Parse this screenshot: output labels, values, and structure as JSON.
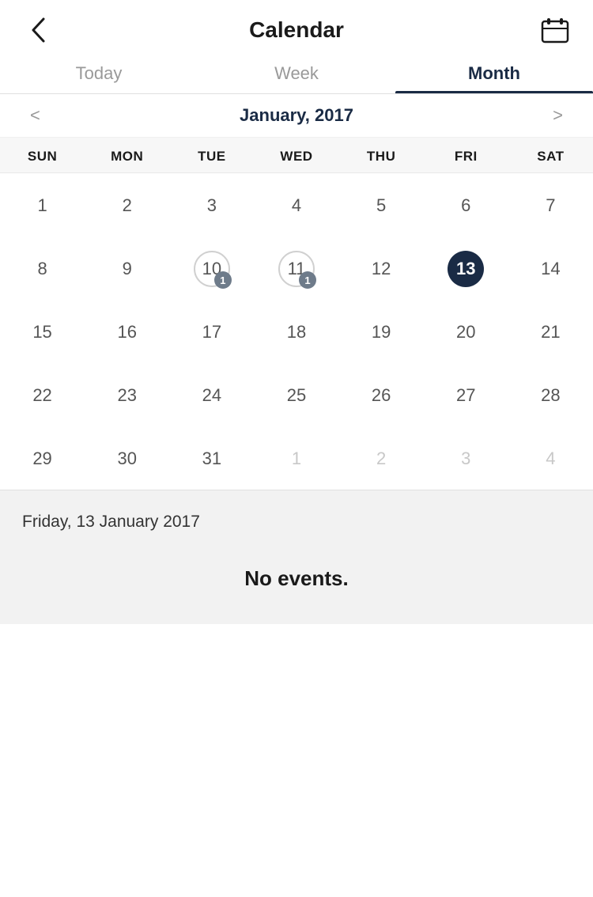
{
  "header": {
    "title": "Calendar",
    "back_label": "<",
    "calendar_icon": "calendar-icon"
  },
  "tabs": [
    {
      "id": "today",
      "label": "Today",
      "active": false
    },
    {
      "id": "week",
      "label": "Week",
      "active": false
    },
    {
      "id": "month",
      "label": "Month",
      "active": true
    }
  ],
  "month_nav": {
    "title": "January, 2017",
    "prev_arrow": "<",
    "next_arrow": ">"
  },
  "day_headers": [
    "SUN",
    "MON",
    "TUE",
    "WED",
    "THU",
    "FRI",
    "SAT"
  ],
  "calendar_weeks": [
    [
      {
        "day": "1",
        "other": false,
        "today": false,
        "ring": false,
        "badge": null
      },
      {
        "day": "2",
        "other": false,
        "today": false,
        "ring": false,
        "badge": null
      },
      {
        "day": "3",
        "other": false,
        "today": false,
        "ring": false,
        "badge": null
      },
      {
        "day": "4",
        "other": false,
        "today": false,
        "ring": false,
        "badge": null
      },
      {
        "day": "5",
        "other": false,
        "today": false,
        "ring": false,
        "badge": null
      },
      {
        "day": "6",
        "other": false,
        "today": false,
        "ring": false,
        "badge": null
      },
      {
        "day": "7",
        "other": false,
        "today": false,
        "ring": false,
        "badge": null
      }
    ],
    [
      {
        "day": "8",
        "other": false,
        "today": false,
        "ring": false,
        "badge": null
      },
      {
        "day": "9",
        "other": false,
        "today": false,
        "ring": false,
        "badge": null
      },
      {
        "day": "10",
        "other": false,
        "today": false,
        "ring": true,
        "badge": "1"
      },
      {
        "day": "11",
        "other": false,
        "today": false,
        "ring": true,
        "badge": "1"
      },
      {
        "day": "12",
        "other": false,
        "today": false,
        "ring": false,
        "badge": null
      },
      {
        "day": "13",
        "other": false,
        "today": true,
        "ring": false,
        "badge": null
      },
      {
        "day": "14",
        "other": false,
        "today": false,
        "ring": false,
        "badge": null
      }
    ],
    [
      {
        "day": "15",
        "other": false,
        "today": false,
        "ring": false,
        "badge": null
      },
      {
        "day": "16",
        "other": false,
        "today": false,
        "ring": false,
        "badge": null
      },
      {
        "day": "17",
        "other": false,
        "today": false,
        "ring": false,
        "badge": null
      },
      {
        "day": "18",
        "other": false,
        "today": false,
        "ring": false,
        "badge": null
      },
      {
        "day": "19",
        "other": false,
        "today": false,
        "ring": false,
        "badge": null
      },
      {
        "day": "20",
        "other": false,
        "today": false,
        "ring": false,
        "badge": null
      },
      {
        "day": "21",
        "other": false,
        "today": false,
        "ring": false,
        "badge": null
      }
    ],
    [
      {
        "day": "22",
        "other": false,
        "today": false,
        "ring": false,
        "badge": null
      },
      {
        "day": "23",
        "other": false,
        "today": false,
        "ring": false,
        "badge": null
      },
      {
        "day": "24",
        "other": false,
        "today": false,
        "ring": false,
        "badge": null
      },
      {
        "day": "25",
        "other": false,
        "today": false,
        "ring": false,
        "badge": null
      },
      {
        "day": "26",
        "other": false,
        "today": false,
        "ring": false,
        "badge": null
      },
      {
        "day": "27",
        "other": false,
        "today": false,
        "ring": false,
        "badge": null
      },
      {
        "day": "28",
        "other": false,
        "today": false,
        "ring": false,
        "badge": null
      }
    ],
    [
      {
        "day": "29",
        "other": false,
        "today": false,
        "ring": false,
        "badge": null
      },
      {
        "day": "30",
        "other": false,
        "today": false,
        "ring": false,
        "badge": null
      },
      {
        "day": "31",
        "other": false,
        "today": false,
        "ring": false,
        "badge": null
      },
      {
        "day": "1",
        "other": true,
        "today": false,
        "ring": false,
        "badge": null
      },
      {
        "day": "2",
        "other": true,
        "today": false,
        "ring": false,
        "badge": null
      },
      {
        "day": "3",
        "other": true,
        "today": false,
        "ring": false,
        "badge": null
      },
      {
        "day": "4",
        "other": true,
        "today": false,
        "ring": false,
        "badge": null
      }
    ]
  ],
  "bottom": {
    "selected_date": "Friday, 13 January 2017",
    "no_events_label": "No events."
  }
}
